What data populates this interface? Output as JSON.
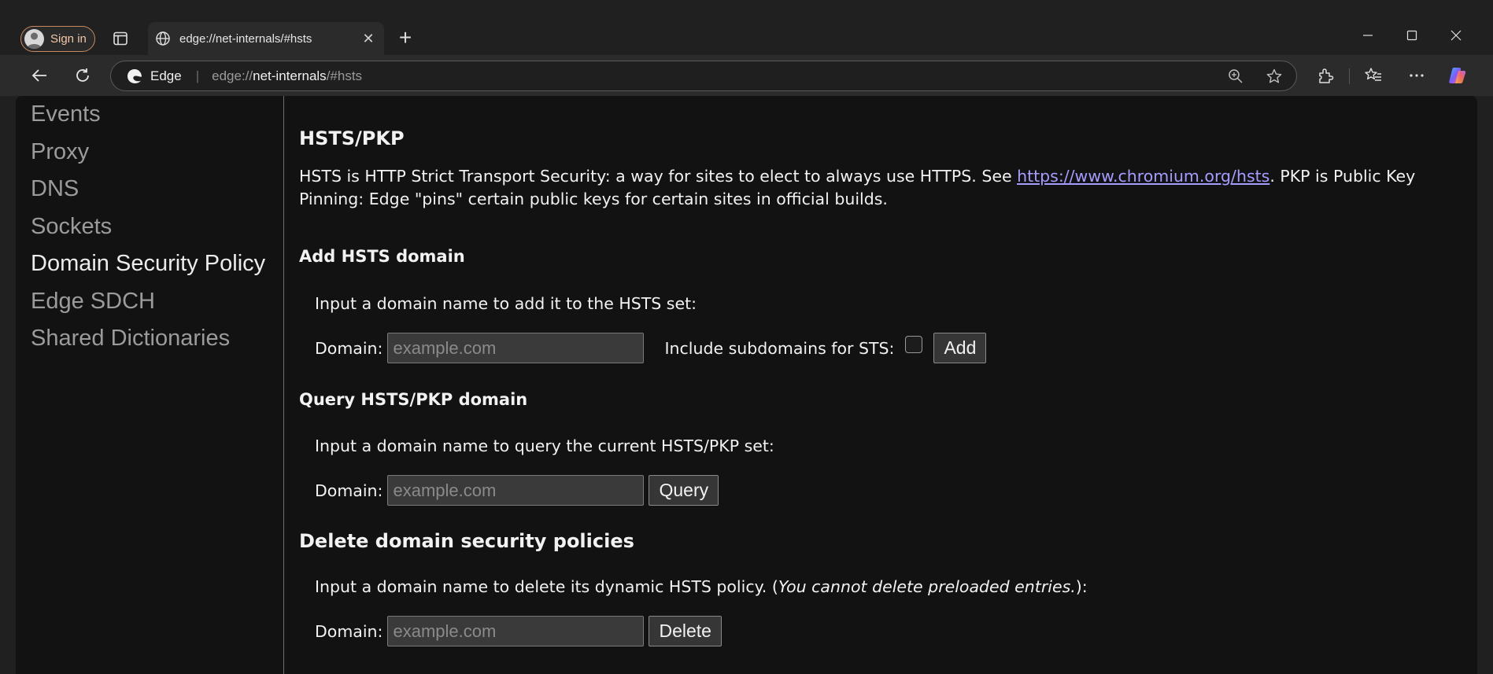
{
  "browser": {
    "signin_label": "Sign in",
    "tab_title": "edge://net-internals/#hsts",
    "tab_close": "✕",
    "new_tab": "+",
    "brand": "Edge",
    "url_scheme": "edge://",
    "url_host": "net-internals",
    "url_hash": "/#hsts"
  },
  "sidebar": {
    "items": [
      {
        "label": "Events"
      },
      {
        "label": "Proxy"
      },
      {
        "label": "DNS"
      },
      {
        "label": "Sockets"
      },
      {
        "label": "Domain Security Policy"
      },
      {
        "label": "Edge SDCH"
      },
      {
        "label": "Shared Dictionaries"
      }
    ],
    "active_index": 4
  },
  "content": {
    "title": "HSTS/PKP",
    "intro_pre": "HSTS is HTTP Strict Transport Security: a way for sites to elect to always use HTTPS. See ",
    "intro_link": "https://www.chromium.org/hsts",
    "intro_post": ". PKP is Public Key Pinning: Edge \"pins\" certain public keys for certain sites in official builds.",
    "add": {
      "heading": "Add HSTS domain",
      "instruction": "Input a domain name to add it to the HSTS set:",
      "domain_label": "Domain:",
      "placeholder": "example.com",
      "subdomains_label": "Include subdomains for STS:",
      "button": "Add"
    },
    "query": {
      "heading": "Query HSTS/PKP domain",
      "instruction": "Input a domain name to query the current HSTS/PKP set:",
      "domain_label": "Domain:",
      "placeholder": "example.com",
      "button": "Query"
    },
    "delete": {
      "heading": "Delete domain security policies",
      "instruction_pre": "Input a domain name to delete its dynamic HSTS policy. (",
      "instruction_em": "You cannot delete preloaded entries.",
      "instruction_post": "):",
      "domain_label": "Domain:",
      "placeholder": "example.com",
      "button": "Delete"
    }
  },
  "colors": {
    "link": "#a59cff",
    "background": "#121212",
    "accent_signin": "#c98a5e"
  }
}
